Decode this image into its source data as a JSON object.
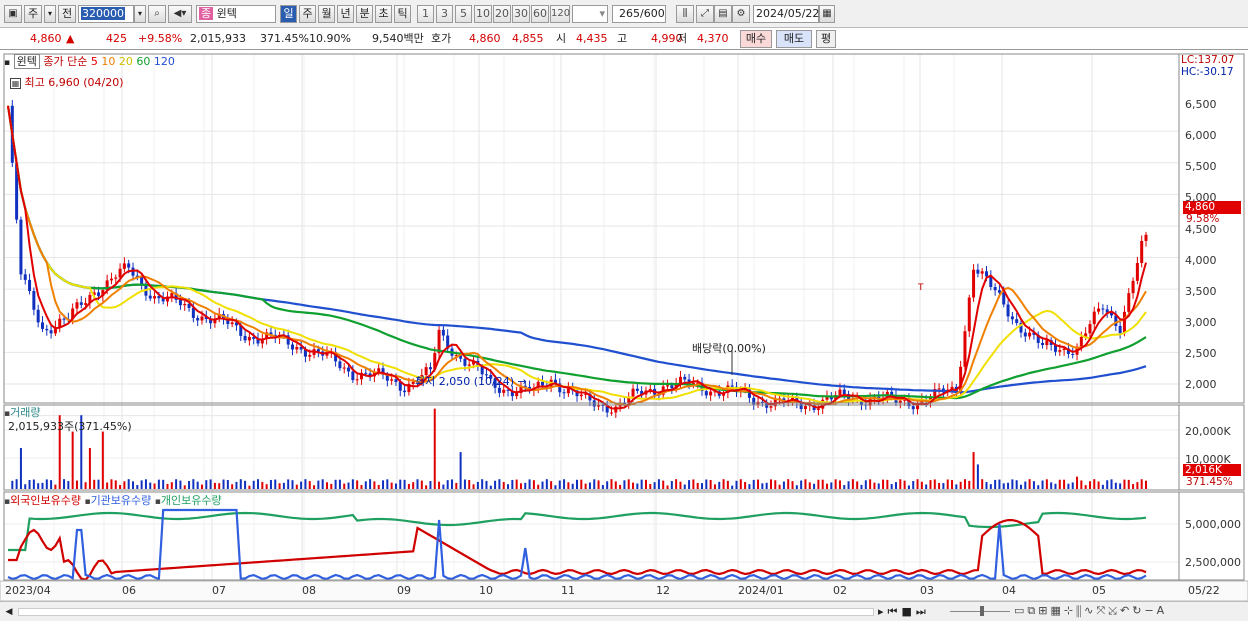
{
  "toolbar": {
    "market": "주",
    "prev_label": "전",
    "code": "320000",
    "stock_name": "윈텍",
    "stock_badge": "종",
    "periods": [
      "일",
      "주",
      "월",
      "년",
      "분",
      "초",
      "틱"
    ],
    "active_period": "일",
    "numbers": [
      "1",
      "3",
      "5",
      "10",
      "20",
      "30",
      "60",
      "120"
    ],
    "count_current": "265",
    "count_total": "/600",
    "date": "2024/05/22"
  },
  "quote": {
    "price": "4,860",
    "arrow": "▲",
    "change": "425",
    "change_pct": "+9.58%",
    "volume": "2,015,933",
    "volume_ratio": "371.45%",
    "turnover": "10.90%",
    "amount": "9,540백만",
    "bid_label": "호가",
    "bid1": "4,860",
    "bid2": "4,855",
    "open_label": "시",
    "open": "4,435",
    "high_label": "고",
    "high": "4,990",
    "low_label": "저",
    "low": "4,370",
    "buy_label": "매수",
    "sell_label": "매도",
    "eval_label": "평"
  },
  "price_panel": {
    "legend_name": "윈텍",
    "legend_ma_label": "종가 단순",
    "ma_periods": [
      "5",
      "10",
      "20",
      "60",
      "120"
    ],
    "high_note": "최고 6,960 (04/20)",
    "low_note": "최저 2,050 (10/24)",
    "dividend_note": "배당락(0.00%)",
    "lc": "LC:137.07",
    "hc": "HC:-30.17",
    "last_price_tag": "4,860",
    "last_pct_tag": "9.58%",
    "t_marker": "T",
    "y_ticks": [
      "6,500",
      "6,000",
      "5,500",
      "5,000",
      "4,500",
      "4,000",
      "3,500",
      "3,000",
      "2,500",
      "2,000"
    ]
  },
  "volume_panel": {
    "title": "거래량",
    "value_note": "2,015,933주(371.45%)",
    "y_ticks": [
      "20,000K",
      "10,000K"
    ],
    "last_tag": "2,016K",
    "last_pct": "371.45%"
  },
  "holding_panel": {
    "series": [
      "외국인보유수량",
      "기관보유수량",
      "개인보유수량"
    ],
    "y_ticks": [
      "5,000,000",
      "2,500,000"
    ]
  },
  "x_axis": {
    "labels": [
      "2023/04",
      "06",
      "07",
      "08",
      "09",
      "10",
      "11",
      "12",
      "2024/01",
      "02",
      "03",
      "04",
      "05",
      "05/22"
    ]
  },
  "colors": {
    "ma5": "#e00000",
    "ma10": "#f08000",
    "ma20": "#f0e000",
    "ma60": "#10a030",
    "ma120": "#2050d0",
    "foreign": "#d00000",
    "institution": "#3060e0",
    "individual": "#20a060"
  },
  "icons": [
    "chart-layout-icon",
    "search-icon",
    "speaker-icon",
    "candle-type-icon",
    "draw-tools-icon",
    "save-icon",
    "settings-icon",
    "calendar-icon"
  ]
}
